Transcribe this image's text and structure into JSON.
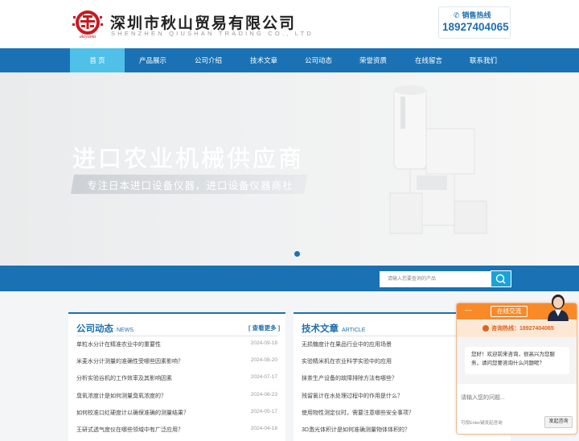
{
  "header": {
    "company_name": "深圳市秋山贸易有限公司",
    "company_name_en": "SHENZHEN QIUSHAN TRADING CO., LTD",
    "logo_text": "akiyama",
    "hotline_label": "销售热线",
    "hotline_number": "18927404065"
  },
  "nav": {
    "items": [
      {
        "label": "首 页",
        "active": true
      },
      {
        "label": "产品展示"
      },
      {
        "label": "公司介绍"
      },
      {
        "label": "技术文章"
      },
      {
        "label": "公司动态"
      },
      {
        "label": "荣誉资质"
      },
      {
        "label": "在线留言"
      },
      {
        "label": "联系我们"
      }
    ]
  },
  "banner": {
    "title": "进口农业机械供应商",
    "subtitle": "专注日本进口设备仪器，进口设备仪器商社",
    "slide_count": 1
  },
  "search": {
    "placeholder": "请输入您要查询的产品"
  },
  "company_news": {
    "title": "公司动态",
    "title_en": "NEWS",
    "more": "[ 查看更多 ]",
    "items": [
      {
        "title": "单粒水分计在精准农业中的重要性",
        "date": "2024-09-18"
      },
      {
        "title": "米麦水分计测量的准确性受哪些因素影响？",
        "date": "2024-08-20"
      },
      {
        "title": "分析实验谷机的工作效率及其影响因素",
        "date": "2024-07-17"
      },
      {
        "title": "臭氧浓度计是如何测量臭氧浓度的？",
        "date": "2024-06-23"
      },
      {
        "title": "如何校准口红硬度计以确保准确的测量结果？",
        "date": "2024-05-17"
      },
      {
        "title": "王研式透气度仪在哪些领域中有广泛应用？",
        "date": "2024-04-18"
      }
    ]
  },
  "tech_articles": {
    "title": "技术文章",
    "title_en": "ARTICLE",
    "items": [
      {
        "title": "无损糖度计在果品行业中的应用场景"
      },
      {
        "title": "实验精米机在农业科学实验中的应用"
      },
      {
        "title": "抹茶生产设备的故障排除方法有哪些？"
      },
      {
        "title": "残留氯计在水处理过程中的作用是什么？"
      },
      {
        "title": "使用物性测定仪时，需要注意哪些安全事项？"
      },
      {
        "title": "3D激光体积计是如何准确测量物体体积的？"
      }
    ]
  },
  "chat": {
    "minimize": "—",
    "title": "在线交流",
    "hotline": "咨询热线：18927404065",
    "greeting": "您好！欢迎前来咨询，很高兴为您服务，请问您要咨询什么问题呢？",
    "input_placeholder": "请输入您的问题...",
    "hint": "可按Enter键发起咨询",
    "send": "发起咨询"
  },
  "colors": {
    "primary": "#1a72b4",
    "nav_active": "#4fc0e8",
    "chat_accent": "#fa8a28"
  }
}
